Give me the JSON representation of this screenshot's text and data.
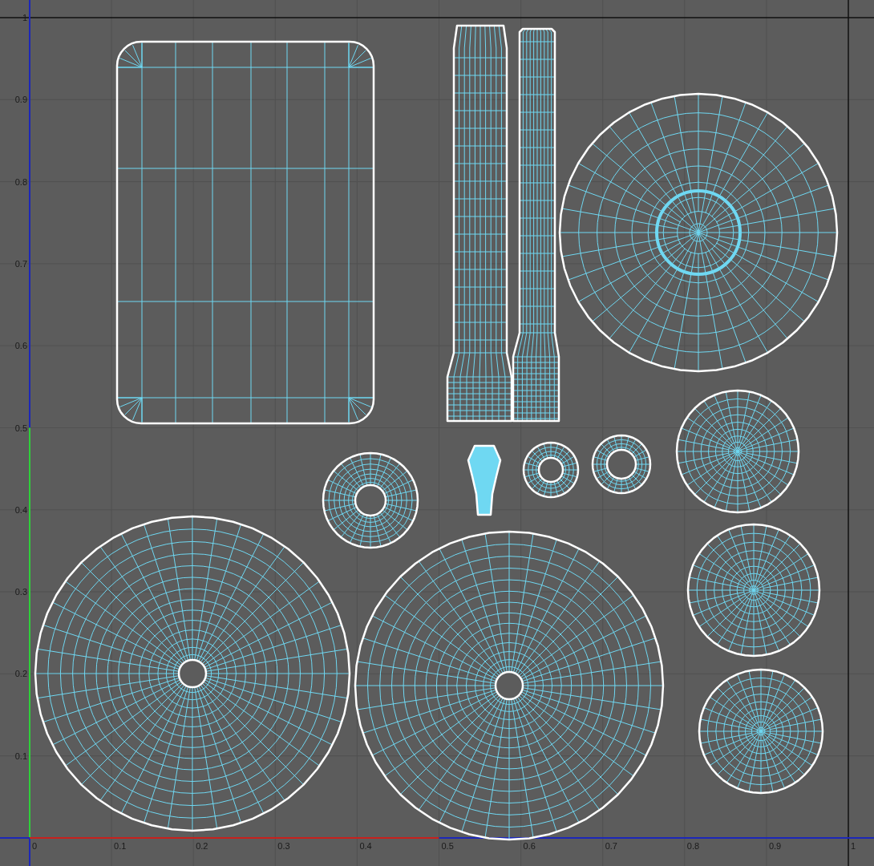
{
  "uv_editor": {
    "y_axis_labels": [
      "1",
      "0.9",
      "0.8",
      "0.7",
      "0.6",
      "0.5",
      "0.4",
      "0.3",
      "0.2",
      "0.1"
    ],
    "x_axis_labels": [
      "0",
      "0.1",
      "0.2",
      "0.3",
      "0.4",
      "0.5",
      "0.6",
      "0.7",
      "0.8",
      "0.9",
      "1"
    ]
  }
}
